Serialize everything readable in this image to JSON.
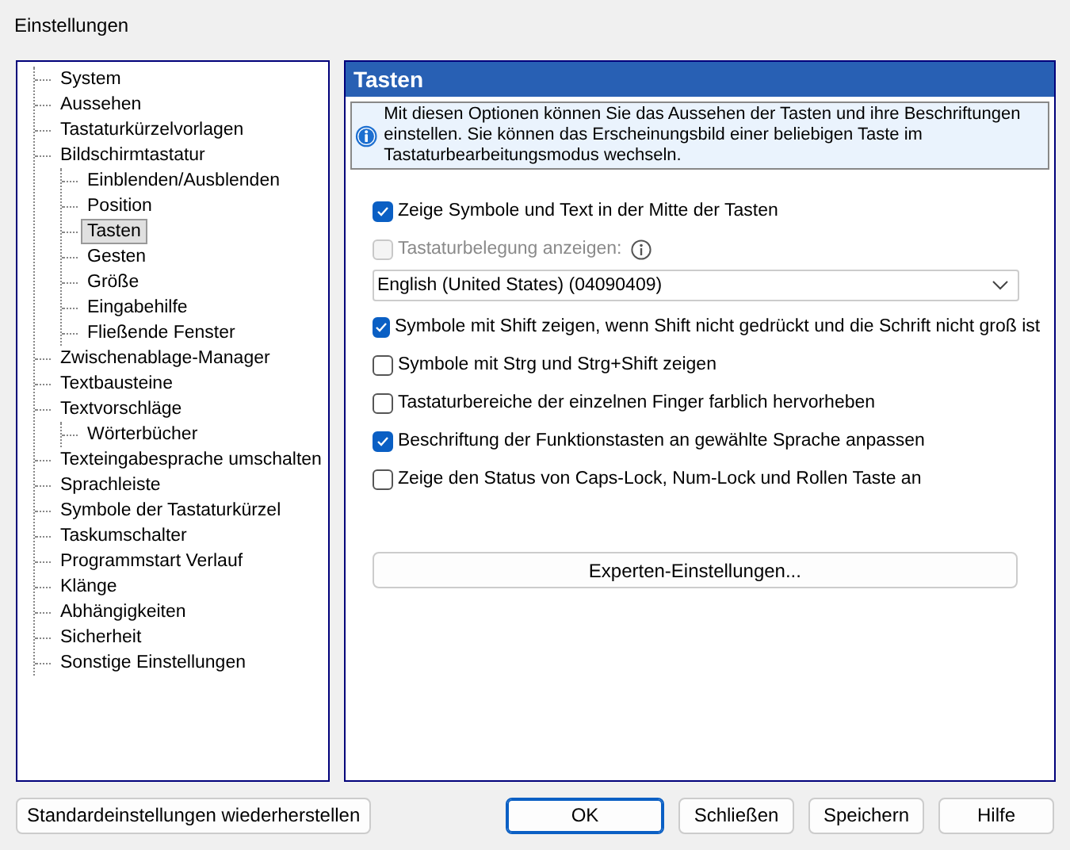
{
  "window": {
    "title": "Einstellungen"
  },
  "tree": [
    {
      "label": "System",
      "selected": false
    },
    {
      "label": "Aussehen",
      "selected": false
    },
    {
      "label": "Tastaturkürzelvorlagen",
      "selected": false
    },
    {
      "label": "Bildschirmtastatur",
      "selected": false,
      "children": [
        {
          "label": "Einblenden/Ausblenden",
          "selected": false
        },
        {
          "label": "Position",
          "selected": false
        },
        {
          "label": "Tasten",
          "selected": true
        },
        {
          "label": "Gesten",
          "selected": false
        },
        {
          "label": "Größe",
          "selected": false
        },
        {
          "label": "Eingabehilfe",
          "selected": false
        },
        {
          "label": "Fließende Fenster",
          "selected": false
        }
      ]
    },
    {
      "label": "Zwischenablage-Manager",
      "selected": false
    },
    {
      "label": "Textbausteine",
      "selected": false
    },
    {
      "label": "Textvorschläge",
      "selected": false,
      "children": [
        {
          "label": "Wörterbücher",
          "selected": false
        }
      ]
    },
    {
      "label": "Texteingabesprache umschalten",
      "selected": false
    },
    {
      "label": "Sprachleiste",
      "selected": false
    },
    {
      "label": "Symbole der Tastaturkürzel",
      "selected": false
    },
    {
      "label": "Taskumschalter",
      "selected": false
    },
    {
      "label": "Programmstart Verlauf",
      "selected": false
    },
    {
      "label": "Klänge",
      "selected": false
    },
    {
      "label": "Abhängigkeiten",
      "selected": false
    },
    {
      "label": "Sicherheit",
      "selected": false
    },
    {
      "label": "Sonstige Einstellungen",
      "selected": false
    }
  ],
  "panel": {
    "title": "Tasten",
    "info": "Mit diesen Optionen können Sie das Aussehen der Tasten und ihre Beschriftungen einstellen. Sie können das Erscheinungsbild einer beliebigen Taste im Tastaturbearbeitungsmodus wechseln.",
    "options": [
      {
        "kind": "checkbox",
        "label": "Zeige Symbole und Text in der Mitte der Tasten",
        "checked": true,
        "disabled": false,
        "help": false
      },
      {
        "kind": "checkbox",
        "label": "Tastaturbelegung anzeigen:",
        "checked": false,
        "disabled": true,
        "help": true
      },
      {
        "kind": "dropdown",
        "value": "English (United States) (04090409)"
      },
      {
        "kind": "checkbox",
        "label": "Symbole mit Shift zeigen, wenn Shift nicht gedrückt und die Schrift nicht groß ist",
        "checked": true,
        "disabled": false,
        "help": false
      },
      {
        "kind": "checkbox",
        "label": "Symbole mit Strg und Strg+Shift zeigen",
        "checked": false,
        "disabled": false,
        "help": false
      },
      {
        "kind": "checkbox",
        "label": "Tastaturbereiche der einzelnen Finger farblich hervorheben",
        "checked": false,
        "disabled": false,
        "help": false
      },
      {
        "kind": "checkbox",
        "label": "Beschriftung der Funktionstasten an gewählte Sprache anpassen",
        "checked": true,
        "disabled": false,
        "help": false
      },
      {
        "kind": "checkbox",
        "label": "Zeige den Status von Caps-Lock, Num-Lock und Rollen Taste an",
        "checked": false,
        "disabled": false,
        "help": false
      }
    ],
    "expert_button": "Experten-Einstellungen..."
  },
  "footer": {
    "reset_button": "Standardeinstellungen wiederherstellen",
    "buttons": [
      {
        "label": "OK",
        "default": true
      },
      {
        "label": "Schließen",
        "default": false
      },
      {
        "label": "Speichern",
        "default": false
      },
      {
        "label": "Hilfe",
        "default": false
      }
    ]
  }
}
